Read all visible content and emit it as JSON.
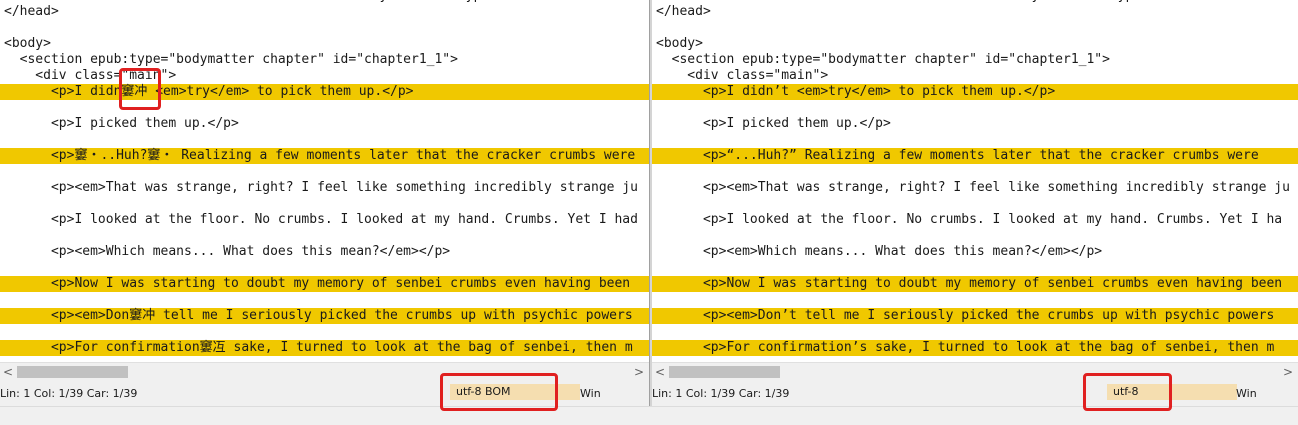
{
  "left": {
    "lines": [
      {
        "text": "  <link href=\"../Text/Reader/reader.css\" for=\"stylesheet\" type=\"extra\"/>",
        "hl": false
      },
      {
        "text": "</head>",
        "hl": false
      },
      {
        "text": "",
        "hl": false
      },
      {
        "text": "<body>",
        "hl": false
      },
      {
        "text": "  <section epub:type=\"bodymatter chapter\" id=\"chapter1_1\">",
        "hl": false
      },
      {
        "text": "    <div class=\"main\">",
        "hl": false
      },
      {
        "text": "      <p>I didn窶冲 <em>try</em> to pick them up.</p>",
        "hl": true
      },
      {
        "text": "",
        "hl": false
      },
      {
        "text": "      <p>I picked them up.</p>",
        "hl": false
      },
      {
        "text": "",
        "hl": false
      },
      {
        "text": "      <p>窶・..Huh?窶・ Realizing a few moments later that the cracker crumbs were",
        "hl": true
      },
      {
        "text": "",
        "hl": false
      },
      {
        "text": "      <p><em>That was strange, right? I feel like something incredibly strange ju",
        "hl": false
      },
      {
        "text": "",
        "hl": false
      },
      {
        "text": "      <p>I looked at the floor. No crumbs. I looked at my hand. Crumbs. Yet I had",
        "hl": false
      },
      {
        "text": "",
        "hl": false
      },
      {
        "text": "      <p><em>Which means... What does this mean?</em></p>",
        "hl": false
      },
      {
        "text": "",
        "hl": false
      },
      {
        "text": "      <p>Now I was starting to doubt my memory of senbei crumbs even having been",
        "hl": true
      },
      {
        "text": "",
        "hl": false
      },
      {
        "text": "      <p><em>Don窶冲 tell me I seriously picked the crumbs up with psychic powers",
        "hl": true
      },
      {
        "text": "",
        "hl": false
      },
      {
        "text": "      <p>For confirmation窶冱 sake, I turned to look at the bag of senbei, then m",
        "hl": true
      }
    ],
    "status_position": "Lin: 1  Col: 1/39  Car: 1/39",
    "status_encoding": "utf-8 BOM",
    "status_eol": "Win"
  },
  "right": {
    "lines": [
      {
        "text": "  <link href=\"../Text/Reader/reader.css\" for=\"stylesheet\" type=\"extra\"/>",
        "hl": false
      },
      {
        "text": "</head>",
        "hl": false
      },
      {
        "text": "",
        "hl": false
      },
      {
        "text": "<body>",
        "hl": false
      },
      {
        "text": "  <section epub:type=\"bodymatter chapter\" id=\"chapter1_1\">",
        "hl": false
      },
      {
        "text": "    <div class=\"main\">",
        "hl": false
      },
      {
        "text": "      <p>I didn’t <em>try</em> to pick them up.</p>",
        "hl": true
      },
      {
        "text": "",
        "hl": false
      },
      {
        "text": "      <p>I picked them up.</p>",
        "hl": false
      },
      {
        "text": "",
        "hl": false
      },
      {
        "text": "      <p>“...Huh?” Realizing a few moments later that the cracker crumbs were",
        "hl": true
      },
      {
        "text": "",
        "hl": false
      },
      {
        "text": "      <p><em>That was strange, right? I feel like something incredibly strange ju",
        "hl": false
      },
      {
        "text": "",
        "hl": false
      },
      {
        "text": "      <p>I looked at the floor. No crumbs. I looked at my hand. Crumbs. Yet I ha",
        "hl": false
      },
      {
        "text": "",
        "hl": false
      },
      {
        "text": "      <p><em>Which means... What does this mean?</em></p>",
        "hl": false
      },
      {
        "text": "",
        "hl": false
      },
      {
        "text": "      <p>Now I was starting to doubt my memory of senbei crumbs even having been",
        "hl": true
      },
      {
        "text": "",
        "hl": false
      },
      {
        "text": "      <p><em>Don’t tell me I seriously picked the crumbs up with psychic powers",
        "hl": true
      },
      {
        "text": "",
        "hl": false
      },
      {
        "text": "      <p>For confirmation’s sake, I turned to look at the bag of senbei, then m",
        "hl": true
      }
    ],
    "status_position": "Lin: 1  Col: 1/39  Car: 1/39",
    "status_encoding": "utf-8",
    "status_eol": "Win"
  },
  "scroll": {
    "left_arrow": "<",
    "right_arrow": ">"
  },
  "colors": {
    "highlight": "#f0c800",
    "annotation": "#e02020",
    "diff_char": "#f2a0a0"
  }
}
